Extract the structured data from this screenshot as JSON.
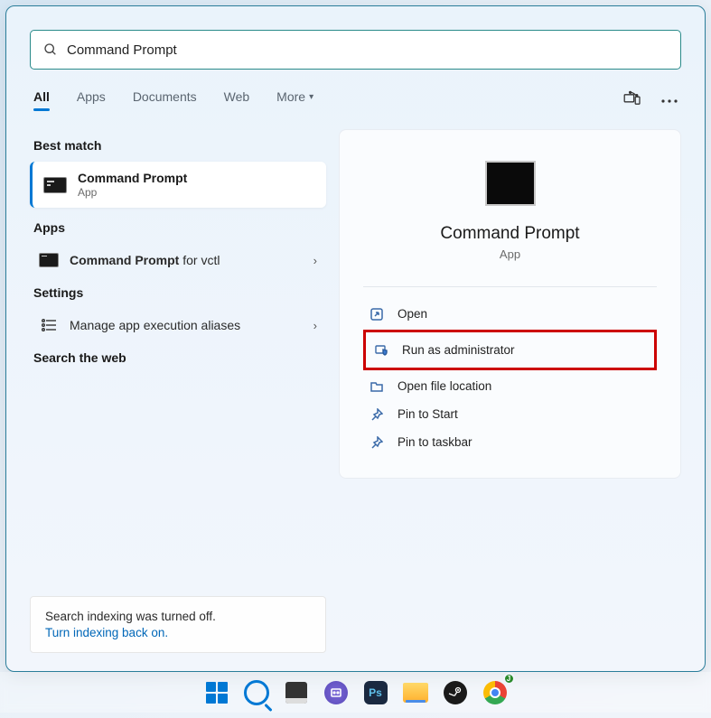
{
  "search": {
    "value": "Command Prompt"
  },
  "tabs": {
    "all": "All",
    "apps": "Apps",
    "documents": "Documents",
    "web": "Web",
    "more": "More"
  },
  "sections": {
    "best_match": "Best match",
    "apps": "Apps",
    "settings": "Settings",
    "search_web": "Search the web"
  },
  "best_match": {
    "title": "Command Prompt",
    "subtitle": "App"
  },
  "apps_list": {
    "item1_prefix": "Command Prompt",
    "item1_suffix": " for vctl"
  },
  "settings_list": {
    "item1": "Manage app execution aliases"
  },
  "indexing": {
    "line1": "Search indexing was turned off.",
    "link": "Turn indexing back on."
  },
  "preview": {
    "title": "Command Prompt",
    "subtitle": "App",
    "actions": {
      "open": "Open",
      "run_admin": "Run as administrator",
      "open_loc": "Open file location",
      "pin_start": "Pin to Start",
      "pin_taskbar": "Pin to taskbar"
    }
  },
  "taskbar": {
    "ps": "Ps",
    "chrome_badge": "J"
  }
}
